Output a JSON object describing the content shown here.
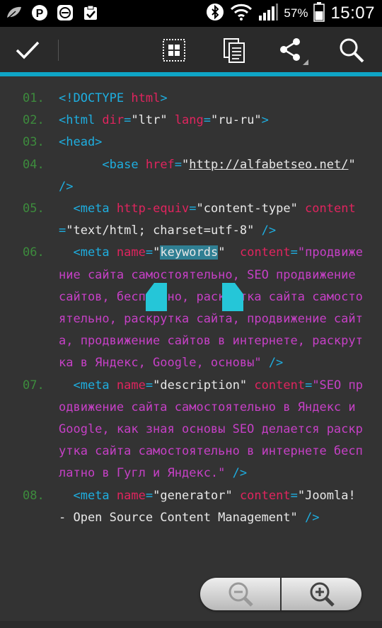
{
  "status_bar": {
    "left_icons": [
      "leaf-icon",
      "pinterest-icon",
      "e-app-icon",
      "clipboard-check-icon"
    ],
    "right_icons": [
      "bluetooth-icon",
      "wifi-icon",
      "signal-icon",
      "battery-icon"
    ],
    "battery_percent": "57%",
    "time": "15:07"
  },
  "action_bar": {
    "buttons": [
      "check-icon",
      "select-all-icon",
      "copy-icon",
      "share-icon",
      "search-icon"
    ],
    "accent_color": "#0fa5c6"
  },
  "code_lines": [
    {
      "num": "01.",
      "segments": [
        [
          "t",
          "<!DOCTYPE "
        ],
        [
          "a",
          "html"
        ],
        [
          "t",
          ">"
        ]
      ]
    },
    {
      "num": "02.",
      "segments": [
        [
          "t",
          "<html "
        ],
        [
          "a",
          "dir"
        ],
        [
          "t",
          "="
        ],
        [
          "v",
          "\"ltr\" "
        ],
        [
          "a",
          "lang"
        ],
        [
          "t",
          "="
        ],
        [
          "v",
          "\"ru-ru\""
        ],
        [
          "t",
          ">"
        ]
      ]
    },
    {
      "num": "03.",
      "segments": [
        [
          "t",
          "<head>"
        ]
      ]
    },
    {
      "num": "04.",
      "segments": [
        [
          "t",
          "      <base "
        ],
        [
          "a",
          "href"
        ],
        [
          "t",
          "="
        ],
        [
          "v",
          "\""
        ],
        [
          "u",
          "http://alfabetseo.net/"
        ],
        [
          "v",
          "\" "
        ],
        [
          "t",
          "/>"
        ]
      ]
    },
    {
      "num": "05.",
      "segments": [
        [
          "t",
          "  <meta "
        ],
        [
          "a",
          "http-equiv"
        ],
        [
          "t",
          "="
        ],
        [
          "v",
          "\"content-type\" "
        ],
        [
          "a",
          "content"
        ],
        [
          "t",
          "="
        ],
        [
          "v",
          "\"text/html; charset=utf-8\" "
        ],
        [
          "t",
          "/>"
        ]
      ]
    },
    {
      "num": "06.",
      "segments": [
        [
          "t",
          "  <meta "
        ],
        [
          "a",
          "name"
        ],
        [
          "t",
          "="
        ],
        [
          "v",
          "\""
        ],
        [
          "sel",
          "keywords"
        ],
        [
          "v",
          "\"  "
        ],
        [
          "a",
          "content"
        ],
        [
          "t",
          "="
        ],
        [
          "s",
          "\"продвижение сайта самостоятельно, SEO продвижение сайтов, бесплатно, раскрутка сайта самостоятельно, раскрутка сайта, продвижение сайта, продвижение сайтов в интернете, раскрутка в Яндекс, Google, основы\" "
        ],
        [
          "t",
          "/>"
        ]
      ]
    },
    {
      "num": "07.",
      "segments": [
        [
          "t",
          "  <meta "
        ],
        [
          "a",
          "name"
        ],
        [
          "t",
          "="
        ],
        [
          "v",
          "\"description\" "
        ],
        [
          "a",
          "content"
        ],
        [
          "t",
          "="
        ],
        [
          "s",
          "\"SEO продвижение сайта самостоятельно в Яндекс и Google, как зная основы SEO делается раскрутка сайта самостоятельно в интернете бесплатно в Гугл и Яндекс.\" "
        ],
        [
          "t",
          "/>"
        ]
      ]
    },
    {
      "num": "08.",
      "segments": [
        [
          "t",
          "  <meta "
        ],
        [
          "a",
          "name"
        ],
        [
          "t",
          "="
        ],
        [
          "v",
          "\"generator\" "
        ],
        [
          "a",
          "content"
        ],
        [
          "t",
          "="
        ],
        [
          "v",
          "\"Joomla! - Open Source Content Management\" "
        ],
        [
          "t",
          "/>"
        ]
      ]
    }
  ],
  "zoom_control": {
    "zoom_out": "zoom-out-icon",
    "zoom_in": "zoom-in-icon"
  }
}
